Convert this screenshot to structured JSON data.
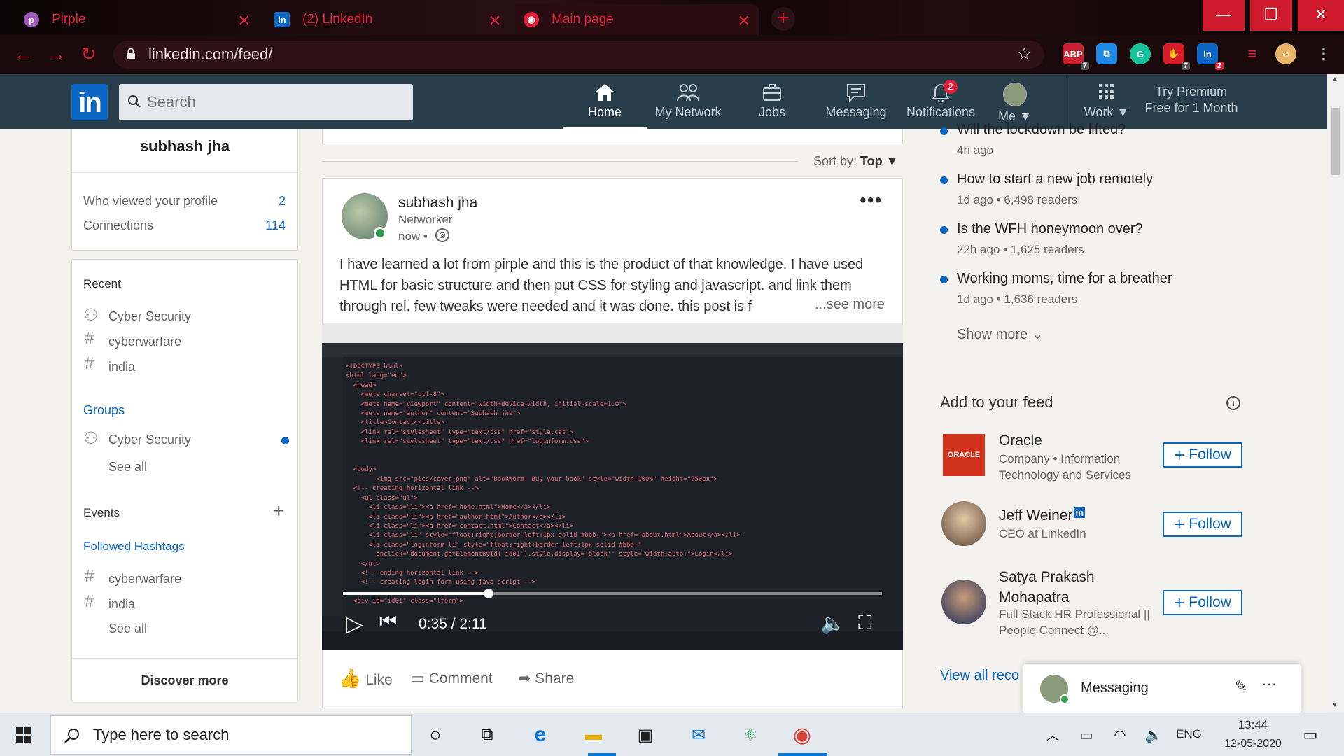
{
  "browser": {
    "tabs": [
      {
        "title": "Pirple",
        "icon": "pirple-favicon"
      },
      {
        "title": "(2) LinkedIn",
        "icon": "linkedin-favicon"
      },
      {
        "title": "Main page",
        "icon": "globe-favicon"
      }
    ],
    "url": "linkedin.com/feed/",
    "extensions": [
      {
        "name": "adblock-icon",
        "badge": "7"
      },
      {
        "name": "screen-share-icon",
        "badge": ""
      },
      {
        "name": "grammarly-icon",
        "badge": ""
      },
      {
        "name": "shield-extension-icon",
        "badge": "7"
      },
      {
        "name": "linkedin-extension-icon",
        "badge": "2"
      }
    ]
  },
  "header": {
    "search_placeholder": "Search",
    "nav": [
      {
        "label": "Home",
        "active": true
      },
      {
        "label": "My Network"
      },
      {
        "label": "Jobs"
      },
      {
        "label": "Messaging"
      },
      {
        "label": "Notifications",
        "badge": "2"
      },
      {
        "label": "Me"
      },
      {
        "label": "Work"
      }
    ],
    "premium": "Try Premium Free for 1 Month"
  },
  "left": {
    "name": "subhash jha",
    "stats": [
      {
        "label": "Who viewed your profile",
        "value": "2"
      },
      {
        "label": "Connections",
        "value": "114"
      }
    ],
    "recent_title": "Recent",
    "recent": [
      "Cyber Security",
      "cyberwarfare",
      "india"
    ],
    "groups_title": "Groups",
    "groups": [
      "Cyber Security"
    ],
    "see_all": "See all",
    "events_title": "Events",
    "hashtags_title": "Followed Hashtags",
    "hashtags": [
      "cyberwarfare",
      "india"
    ],
    "see_all2": "See all",
    "discover": "Discover more"
  },
  "feed": {
    "sort_label": "Sort by:",
    "sort_value": "Top",
    "post": {
      "author": "subhash jha",
      "headline": "Networker",
      "time": "now •",
      "text": "I have learned a lot from pirple and this is the product of that knowledge. I have used HTML for basic structure and then put CSS for styling and javascript.  and link them through rel. few tweaks were needed and it was done. this post is f",
      "see_more": "...see more",
      "video_time": "0:35 / 2:11",
      "video_progress": 0.27,
      "actions": [
        "Like",
        "Comment",
        "Share"
      ]
    }
  },
  "right": {
    "news": [
      {
        "title": "Will the lockdown be lifted?",
        "meta": "4h ago"
      },
      {
        "title": "How to start a new job remotely",
        "meta": "1d ago • 6,498 readers"
      },
      {
        "title": "Is the WFH honeymoon over?",
        "meta": "22h ago • 1,625 readers"
      },
      {
        "title": "Working moms, time for a breather",
        "meta": "1d ago • 1,636 readers"
      }
    ],
    "show_more": "Show more",
    "feed_title": "Add to your feed",
    "suggestions": [
      {
        "name": "Oracle",
        "desc": "Company • Information Technology and Services",
        "button": "Follow"
      },
      {
        "name": "Jeff Weiner",
        "desc": "CEO at LinkedIn",
        "button": "Follow"
      },
      {
        "name": "Satya Prakash Mohapatra",
        "desc": "Full Stack HR Professional || People Connect @...",
        "button": "Follow"
      }
    ],
    "view_all": "View all reco",
    "messaging": "Messaging"
  },
  "taskbar": {
    "search_placeholder": "Type here to search",
    "language": "ENG",
    "time": "13:44",
    "date": "12-05-2020"
  },
  "colors": {
    "linkedin_header": "#283e4a",
    "linkedin_blue": "#0a66c2",
    "chrome_red": "#e0203a"
  }
}
